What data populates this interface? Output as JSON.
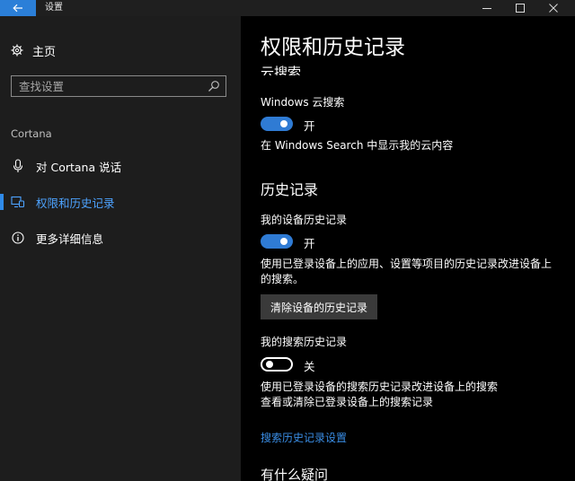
{
  "window": {
    "title": "设置",
    "accent": "#2b7fd8"
  },
  "sidebar": {
    "home_label": "主页",
    "search": {
      "placeholder": "查找设置",
      "value": ""
    },
    "section_title": "Cortana",
    "items": [
      {
        "label": "对 Cortana 说话",
        "icon": "microphone-icon",
        "active": false
      },
      {
        "label": "权限和历史记录",
        "icon": "permissions-icon",
        "active": true
      },
      {
        "label": "更多详细信息",
        "icon": "info-icon",
        "active": false
      }
    ]
  },
  "main": {
    "page_title": "权限和历史记录",
    "cut_heading_top": "云搜索",
    "cloud_search": {
      "label": "Windows 云搜索",
      "state": "开",
      "on": true,
      "description": "在 Windows Search 中显示我的云内容"
    },
    "history": {
      "heading": "历史记录",
      "device_history": {
        "label": "我的设备历史记录",
        "state": "开",
        "on": true,
        "description": "使用已登录设备上的应用、设置等项目的历史记录改进设备上的搜索。"
      },
      "clear_button": "清除设备的历史记录",
      "search_history": {
        "label": "我的搜索历史记录",
        "state": "关",
        "on": false,
        "description_line1": "使用已登录设备的搜索历史记录改进设备上的搜索",
        "description_line2": "查看或清除已登录设备上的搜索记录"
      },
      "link": "搜索历史记录设置"
    },
    "cut_heading_bottom": "有什么疑问"
  }
}
